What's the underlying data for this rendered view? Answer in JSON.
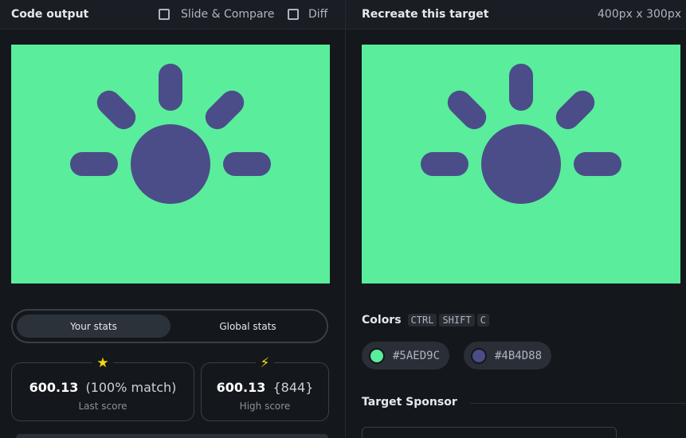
{
  "left": {
    "title": "Code output",
    "slide_compare_label": "Slide & Compare",
    "diff_label": "Diff"
  },
  "right": {
    "title": "Recreate this target",
    "dims": "400px x 300px"
  },
  "stats": {
    "tab_your": "Your stats",
    "tab_global": "Global stats",
    "last": {
      "value": "600.13",
      "extra": "(100% match)",
      "label": "Last score",
      "icon": "star-icon"
    },
    "high": {
      "value": "600.13",
      "extra": "{844}",
      "label": "High score",
      "icon": "bolt-icon"
    }
  },
  "colors": {
    "label": "Colors",
    "shortcut": [
      "CTRL",
      "SHIFT",
      "C"
    ],
    "swatches": [
      {
        "hex": "#5AED9C",
        "label": "#5AED9C"
      },
      {
        "hex": "#4B4D88",
        "label": "#4B4D88"
      }
    ]
  },
  "sponsor": {
    "label": "Target Sponsor"
  },
  "theme": {
    "canvas_bg": "#5AED9C",
    "shape_fill": "#4B4D88"
  }
}
